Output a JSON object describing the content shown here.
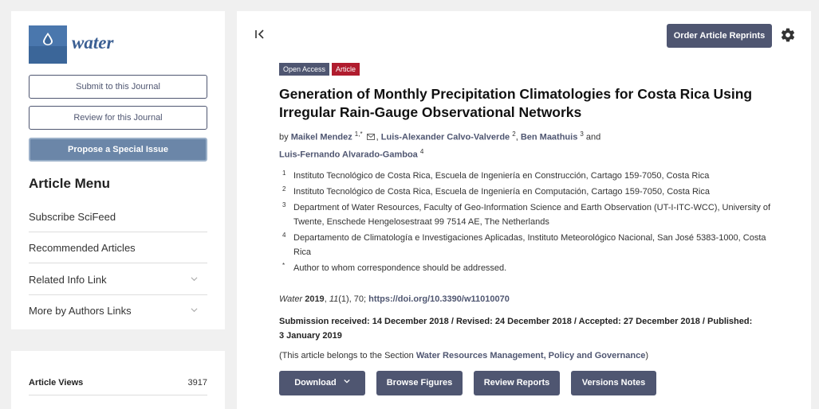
{
  "sidebar": {
    "logo_text": "water",
    "submit_label": "Submit to this Journal",
    "review_label": "Review for this Journal",
    "propose_label": "Propose a Special Issue",
    "menu_title": "Article Menu",
    "menu_items": [
      {
        "label": "Subscribe SciFeed",
        "icon": null
      },
      {
        "label": "Recommended Articles",
        "icon": null
      },
      {
        "label": "Related Info Link",
        "icon": "chevron-down-icon"
      },
      {
        "label": "More by Authors Links",
        "icon": "chevron-down-icon"
      }
    ],
    "stats": {
      "label": "Article Views",
      "value": "3917"
    }
  },
  "header": {
    "reprint_label": "Order Article Reprints"
  },
  "article": {
    "badges": {
      "open_access": "Open Access",
      "type": "Article"
    },
    "title": "Generation of Monthly Precipitation Climatologies for Costa Rica Using Irregular Rain-Gauge Observational Networks",
    "by": "by",
    "authors": [
      {
        "name": "Maikel Mendez",
        "sup": "1,*"
      },
      {
        "name": "Luis-Alexander Calvo-Valverde",
        "sup": "2"
      },
      {
        "name": "Ben Maathuis",
        "sup": "3"
      },
      {
        "name": "Luis-Fernando Alvarado-Gamboa",
        "sup": "4"
      }
    ],
    "and": "and",
    "affiliations": [
      {
        "n": "1",
        "text": "Instituto Tecnológico de Costa Rica, Escuela de Ingeniería en Construcción, Cartago 159-7050, Costa Rica"
      },
      {
        "n": "2",
        "text": "Instituto Tecnológico de Costa Rica, Escuela de Ingeniería en Computación, Cartago 159-7050, Costa Rica"
      },
      {
        "n": "3",
        "text": "Department of Water Resources, Faculty of Geo-Information Science and Earth Observation (UT-I-ITC-WCC), University of Twente, Enschede Hengelosestraat 99 7514 AE, The Netherlands"
      },
      {
        "n": "4",
        "text": "Departamento de Climatología e Investigaciones Aplicadas, Instituto Meteorológico Nacional, San José 5383-1000, Costa Rica"
      },
      {
        "n": "*",
        "text": "Author to whom correspondence should be addressed."
      }
    ],
    "citation": {
      "journal": "Water",
      "year": "2019",
      "volume": "11",
      "rest": "(1), 70; ",
      "doi": "https://doi.org/10.3390/w11010070"
    },
    "dates": "Submission received: 14 December 2018 / Revised: 24 December 2018 / Accepted: 27 December 2018 / Published: 3 January 2019",
    "section": {
      "prefix": "(This article belongs to the Section ",
      "name": "Water Resources Management, Policy and Governance",
      "suffix": ")"
    }
  },
  "actions": {
    "download": "Download",
    "browse_figures": "Browse Figures",
    "review_reports": "Review Reports",
    "versions_notes": "Versions Notes"
  },
  "colors": {
    "primary": "#4f5671",
    "badge_article": "#b01c2e",
    "propose": "#6b86a8"
  }
}
